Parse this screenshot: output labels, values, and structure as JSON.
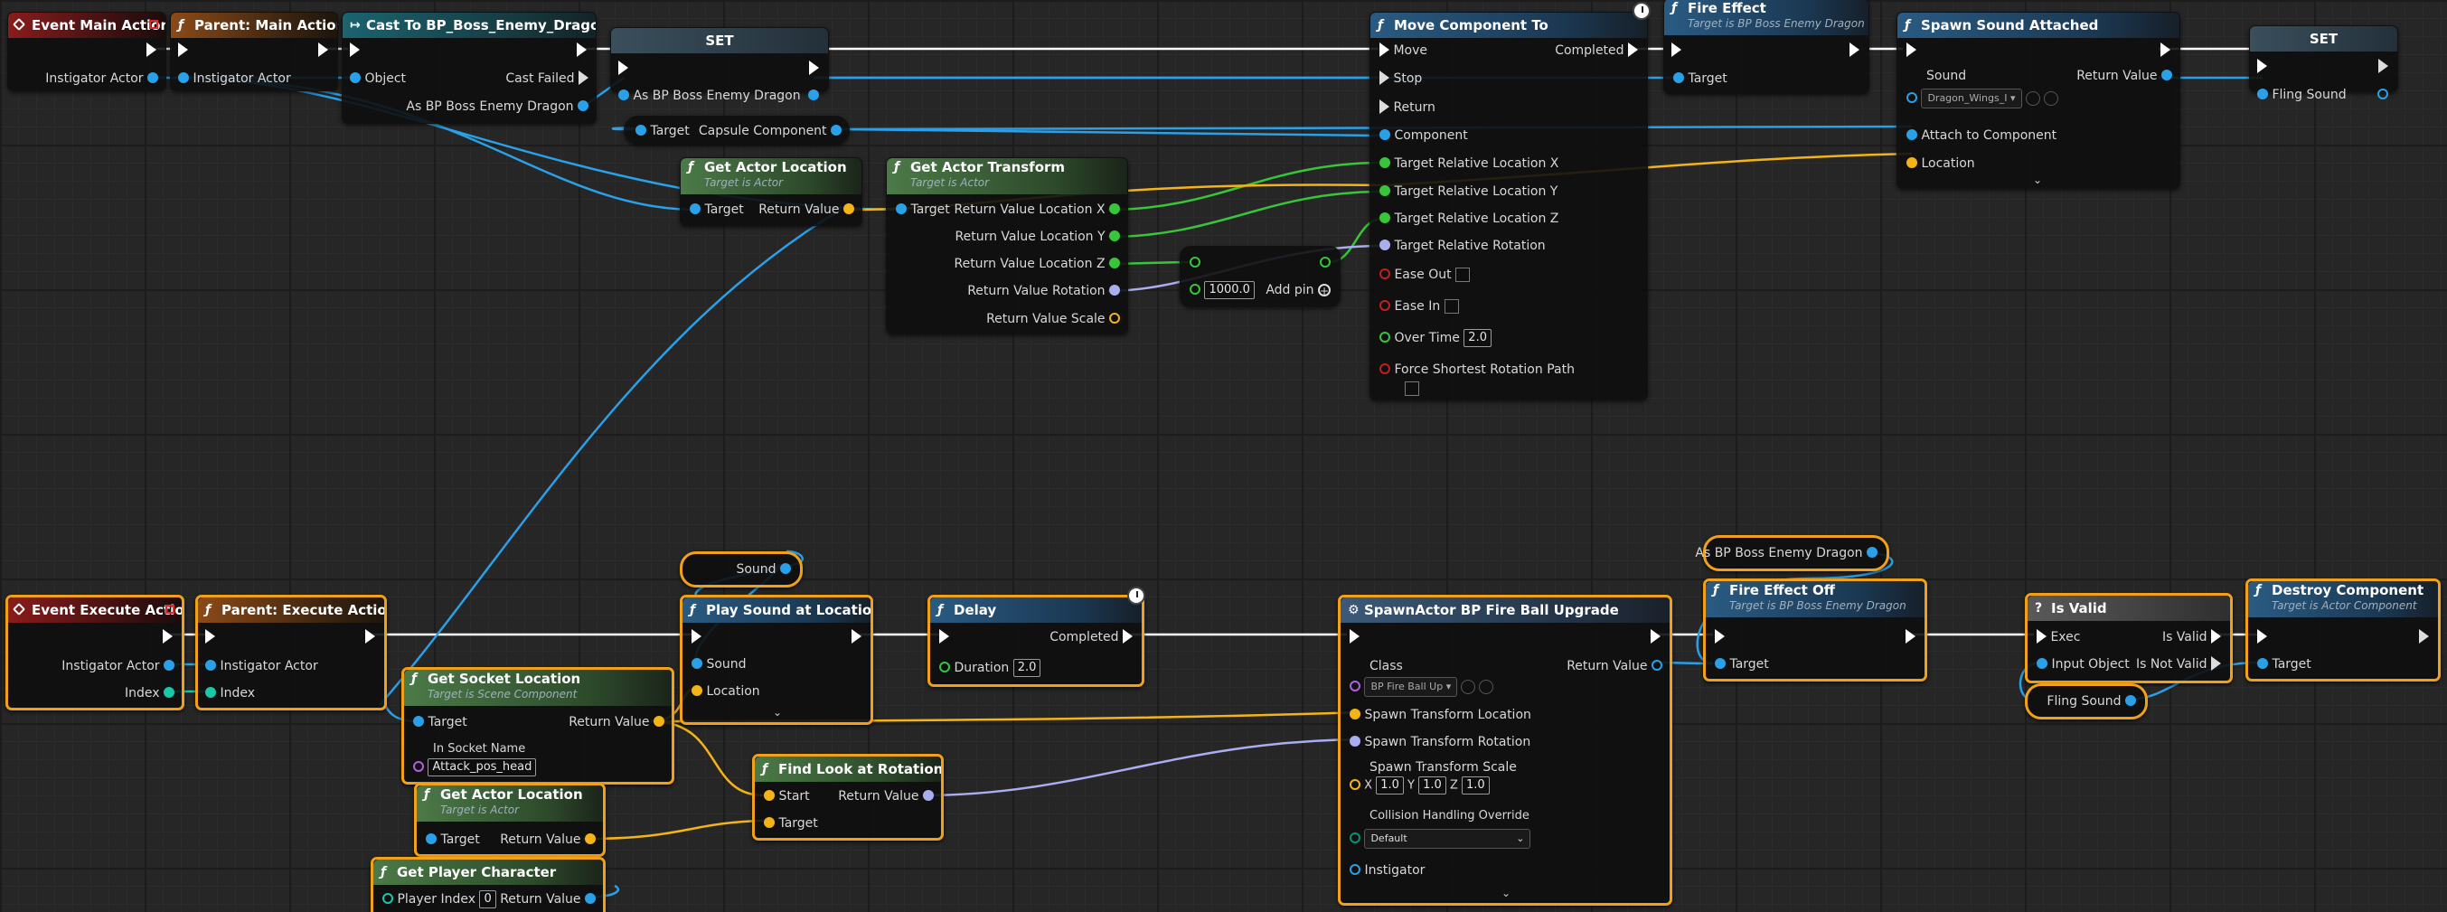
{
  "graph": {
    "event_main": {
      "title": "Event Main Action",
      "pin": "Instigator Actor"
    },
    "parent_main": {
      "title": "Parent: Main Action",
      "pin": "Instigator Actor"
    },
    "cast": {
      "title": "Cast To BP_Boss_Enemy_Dragon",
      "object": "Object",
      "cast_failed": "Cast Failed",
      "as_out": "As BP Boss Enemy Dragon"
    },
    "set1": {
      "title": "SET",
      "pin": "As BP Boss Enemy Dragon"
    },
    "capsule": {
      "target": "Target",
      "out": "Capsule Component"
    },
    "get_actor_location_top": {
      "title": "Get Actor Location",
      "subtitle": "Target is Actor",
      "target": "Target",
      "ret": "Return Value"
    },
    "get_actor_transform": {
      "title": "Get Actor Transform",
      "subtitle": "Target is Actor",
      "target": "Target",
      "pins": [
        "Return Value Location X",
        "Return Value Location Y",
        "Return Value Location Z",
        "Return Value Rotation",
        "Return Value Scale"
      ]
    },
    "add_node": {
      "value": "1000.0",
      "add_pin": "Add pin"
    },
    "move_component": {
      "title": "Move Component To",
      "move": "Move",
      "completed": "Completed",
      "stop": "Stop",
      "return": "Return",
      "component": "Component",
      "loc_x": "Target Relative Location X",
      "loc_y": "Target Relative Location Y",
      "loc_z": "Target Relative Location Z",
      "rotation": "Target Relative Rotation",
      "ease_out": "Ease Out",
      "ease_in": "Ease In",
      "over_time": "Over Time",
      "over_time_val": "2.0",
      "shortest": "Force Shortest Rotation Path"
    },
    "fire_effect": {
      "title": "Fire Effect",
      "subtitle": "Target is BP Boss Enemy Dragon",
      "target": "Target"
    },
    "spawn_sound_attached": {
      "title": "Spawn Sound Attached",
      "sound": "Sound",
      "sound_val": "Dragon_Wings_I",
      "ret": "Return Value",
      "attach": "Attach to Component",
      "location": "Location"
    },
    "set2": {
      "title": "SET",
      "pin": "Fling Sound"
    },
    "event_execute": {
      "title": "Event Execute Action",
      "pin1": "Instigator Actor",
      "pin2": "Index"
    },
    "parent_execute": {
      "title": "Parent: Execute Action",
      "pin1": "Instigator Actor",
      "pin2": "Index"
    },
    "sound_var": {
      "label": "Sound"
    },
    "play_sound": {
      "title": "Play Sound at Location",
      "sound": "Sound",
      "location": "Location"
    },
    "delay": {
      "title": "Delay",
      "completed": "Completed",
      "duration": "Duration",
      "duration_val": "2.0"
    },
    "get_socket_location": {
      "title": "Get Socket Location",
      "subtitle": "Target is Scene Component",
      "target": "Target",
      "ret": "Return Value",
      "socket": "In Socket Name",
      "socket_val": "Attack_pos_head"
    },
    "find_look": {
      "title": "Find Look at Rotation",
      "start": "Start",
      "target": "Target",
      "ret": "Return Value"
    },
    "get_actor_location_bottom": {
      "title": "Get Actor Location",
      "subtitle": "Target is Actor",
      "target": "Target",
      "ret": "Return Value"
    },
    "get_player_character": {
      "title": "Get Player Character",
      "index": "Player Index",
      "index_val": "0",
      "ret": "Return Value"
    },
    "spawn_actor": {
      "title": "SpawnActor BP Fire Ball Upgrade",
      "class": "Class",
      "class_val": "BP Fire Ball Up",
      "ret": "Return Value",
      "loc": "Spawn Transform Location",
      "rot": "Spawn Transform Rotation",
      "scale": "Spawn Transform Scale",
      "sx": "1.0",
      "sy": "1.0",
      "sz": "1.0",
      "collision": "Collision Handling Override",
      "collision_val": "Default",
      "instigator": "Instigator",
      "x": "X",
      "y": "Y",
      "z": "Z"
    },
    "as_dragon_var": {
      "label": "As BP Boss Enemy Dragon"
    },
    "fire_effect_off": {
      "title": "Fire Effect Off",
      "subtitle": "Target is BP Boss Enemy Dragon",
      "target": "Target"
    },
    "is_valid": {
      "title": "Is Valid",
      "exec": "Exec",
      "is_valid": "Is Valid",
      "input": "Input Object",
      "not_valid": "Is Not Valid"
    },
    "fling_var": {
      "label": "Fling Sound"
    },
    "destroy_component": {
      "title": "Destroy Component",
      "subtitle": "Target is Actor Component",
      "target": "Target"
    }
  },
  "colors": {
    "exec": "#ffffff",
    "object": "#2aa0e8",
    "float": "#38c53a",
    "vector": "#f4b418",
    "rotator": "#a8aef0",
    "int": "#18c8a8",
    "selection": "#f0a019"
  }
}
